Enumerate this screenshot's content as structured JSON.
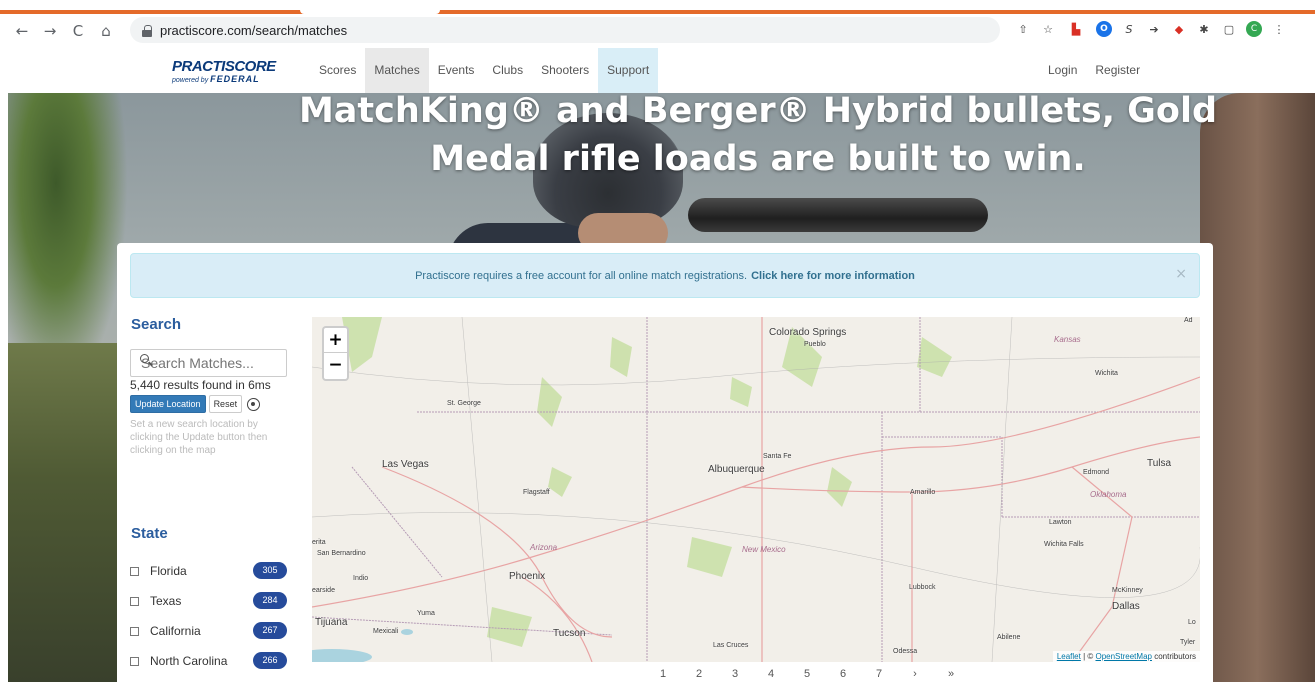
{
  "browser": {
    "url": "practiscore.com/search/matches",
    "nav_icons": {
      "back": "←",
      "forward": "→",
      "reload": "C",
      "home": "⌂"
    },
    "extensions": [
      "share-icon",
      "star-icon",
      "extension-red-icon",
      "opera-icon",
      "s-icon",
      "arrow-icon",
      "red-extension-icon",
      "puzzle-icon",
      "sidebar-icon",
      "profile-icon"
    ]
  },
  "site": {
    "logo": {
      "main": "PRACTISCORE",
      "powered_by": "powered by",
      "brand": "FEDERAL"
    },
    "nav": [
      "Scores",
      "Matches",
      "Events",
      "Clubs",
      "Shooters",
      "Support"
    ],
    "active_nav": "Matches",
    "login": "Login",
    "register": "Register"
  },
  "hero": {
    "line1": "MatchKing® and Berger® Hybrid bullets, Gold",
    "line2": "Medal rifle loads are built to win."
  },
  "alert": {
    "text": "Practiscore requires a free account for all online match registrations.",
    "link": "Click here for more information",
    "close": "×"
  },
  "search": {
    "title": "Search",
    "placeholder": "Search Matches...",
    "results": "5,440 results found in 6ms",
    "update_label": "Update Location",
    "reset_label": "Reset",
    "help": "Set a new search location by clicking the Update button then clicking on the map"
  },
  "state": {
    "title": "State",
    "items": [
      {
        "name": "Florida",
        "count": "305"
      },
      {
        "name": "Texas",
        "count": "284"
      },
      {
        "name": "California",
        "count": "267"
      },
      {
        "name": "North Carolina",
        "count": "266"
      }
    ]
  },
  "map": {
    "zoom_in": "+",
    "zoom_out": "−",
    "cities": [
      "Colorado Springs",
      "Pueblo",
      "Wichita",
      "St. George",
      "Las Vegas",
      "Santa Fe",
      "Albuquerque",
      "Flagstaff",
      "Amarillo",
      "Edmond",
      "Tulsa",
      "Lawton",
      "Wichita Falls",
      "San Bernardino",
      "Indio",
      "Phoenix",
      "Lubbock",
      "McKinney",
      "Dallas",
      "Yuma",
      "Tijuana",
      "Mexicali",
      "Tucson",
      "Las Cruces",
      "Abilene",
      "Tyler",
      "Odessa",
      "Lo",
      "Ad",
      "erita",
      "earside"
    ],
    "states": [
      "Kansas",
      "Oklahoma",
      "Arizona",
      "New Mexico"
    ],
    "attribution_leaflet": "Leaflet",
    "attribution_sep": " | © ",
    "attribution_osm": "OpenStreetMap",
    "attribution_rest": " contributors"
  },
  "pagination": [
    "1",
    "2",
    "3",
    "4",
    "5",
    "6",
    "7",
    "›",
    "»"
  ]
}
